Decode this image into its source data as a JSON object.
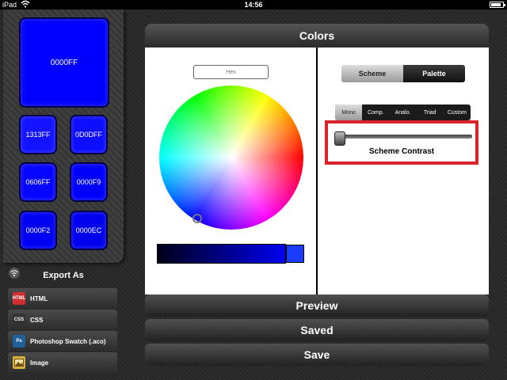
{
  "status_bar": {
    "device": "iPad",
    "time": "14:56",
    "battery_level": 0.85
  },
  "swatches": {
    "main": {
      "hex": "0000FF",
      "color": "#0000FF"
    },
    "grid": [
      {
        "hex": "1313FF",
        "color": "#1313FF"
      },
      {
        "hex": "0D0DFF",
        "color": "#0D0DFF"
      },
      {
        "hex": "0606FF",
        "color": "#0606FF"
      },
      {
        "hex": "0000F9",
        "color": "#0000F9"
      },
      {
        "hex": "0000F2",
        "color": "#0000F2"
      },
      {
        "hex": "0000EC",
        "color": "#0000EC"
      }
    ]
  },
  "export": {
    "title": "Export As",
    "items": [
      {
        "label": "HTML",
        "icon_text": "HTML",
        "icon": "html-icon",
        "icon_bg": "#d03030"
      },
      {
        "label": "CSS",
        "icon_text": "CSS",
        "icon": "css-icon",
        "icon_bg": "#333333"
      },
      {
        "label": "Photoshop Swatch (.aco)",
        "icon_text": "Ps",
        "icon": "photoshop-icon",
        "icon_bg": "#1f5f9a"
      },
      {
        "label": "Image",
        "icon_text": "",
        "icon": "image-icon",
        "icon_bg": "#d8b040"
      }
    ]
  },
  "main": {
    "title": "Colors",
    "hex_placeholder": "Hex",
    "tabs": [
      {
        "label": "Scheme",
        "selected": true
      },
      {
        "label": "Palette",
        "selected": false
      }
    ],
    "modes": [
      {
        "label": "Mono",
        "selected": true
      },
      {
        "label": "Comp.",
        "selected": false
      },
      {
        "label": "Analo.",
        "selected": false
      },
      {
        "label": "Triad",
        "selected": false
      },
      {
        "label": "Custom",
        "selected": false
      }
    ],
    "contrast_label": "Scheme Contrast",
    "contrast_value": 0.0,
    "brightness_color": "#1A3CFF"
  },
  "bottom_buttons": {
    "preview": "Preview",
    "saved": "Saved",
    "save": "Save"
  }
}
